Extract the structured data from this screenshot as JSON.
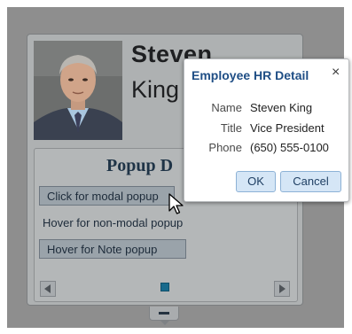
{
  "card": {
    "first_name": "Steven",
    "last_name": "King",
    "demo_title": "Popup D",
    "modal_button_label": "Click for modal popup",
    "nonmodal_link_label": "Hover for non-modal popup",
    "note_button_label": "Hover for Note popup"
  },
  "dialog": {
    "title": "Employee HR Detail",
    "close_glyph": "×",
    "fields": [
      {
        "label": "Name",
        "value": "Steven King"
      },
      {
        "label": "Title",
        "value": "Vice President"
      },
      {
        "label": "Phone",
        "value": "(650) 555-0100"
      }
    ],
    "ok_label": "OK",
    "cancel_label": "Cancel"
  },
  "icons": {
    "prev": "chevron-left-icon",
    "next": "chevron-right-icon",
    "close": "close-icon",
    "cursor": "mouse-pointer-icon",
    "collapse": "collapse-handle-icon"
  },
  "colors": {
    "overlay": "#8e8e8e",
    "dialog_title": "#1f4e85",
    "button_bg": "#d5e6f6",
    "page_dot": "#186a8c"
  },
  "carousel": {
    "page_count": 1,
    "current_page": 1
  }
}
